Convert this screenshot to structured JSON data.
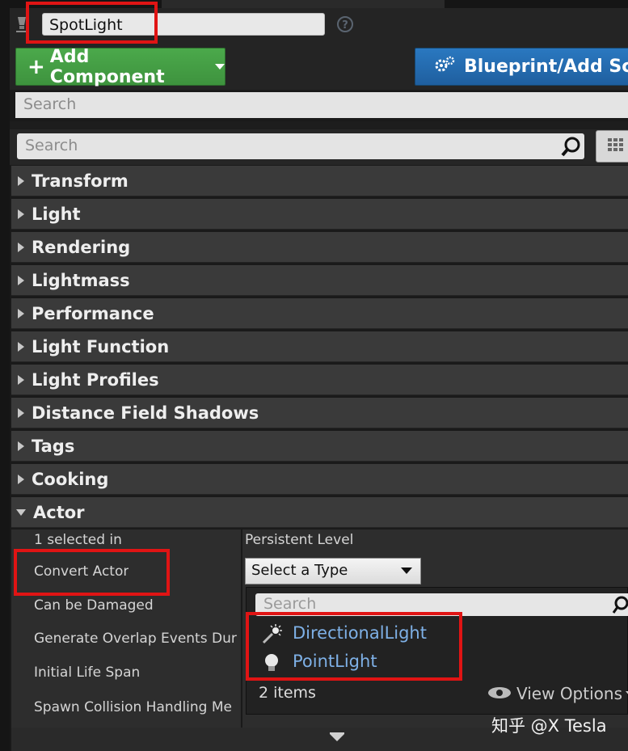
{
  "details": {
    "actor_name": "SpotLight",
    "add_component_label": "Add Component",
    "blueprint_label": "Blueprint/Add Sc",
    "component_search_placeholder": "Search",
    "details_search_placeholder": "Search"
  },
  "sections": [
    {
      "label": "Transform"
    },
    {
      "label": "Light"
    },
    {
      "label": "Rendering"
    },
    {
      "label": "Lightmass"
    },
    {
      "label": "Performance"
    },
    {
      "label": "Light Function"
    },
    {
      "label": "Light Profiles"
    },
    {
      "label": "Distance Field Shadows"
    },
    {
      "label": "Tags"
    },
    {
      "label": "Cooking"
    },
    {
      "label": "Actor"
    }
  ],
  "actor": {
    "selected_label": "1 selected in",
    "selected_value": "Persistent Level",
    "convert_label": "Convert Actor",
    "convert_dropdown": "Select a Type",
    "can_be_damaged": "Can be Damaged",
    "overlap_events": "Generate Overlap Events Dur",
    "initial_life_span": "Initial Life Span",
    "spawn_collision": "Spawn Collision Handling Me"
  },
  "popup": {
    "search_placeholder": "Search",
    "items": [
      {
        "label": "DirectionalLight",
        "icon": "directional-light-icon"
      },
      {
        "label": "PointLight",
        "icon": "point-light-icon"
      }
    ],
    "count": "2 items",
    "view_options": "View Options"
  },
  "watermark": "知乎 @X Tesla",
  "colors": {
    "add_button": "#3e933e",
    "blueprint_button": "#1f5f9f",
    "highlight": "#e01414",
    "link": "#7eb0e6"
  }
}
